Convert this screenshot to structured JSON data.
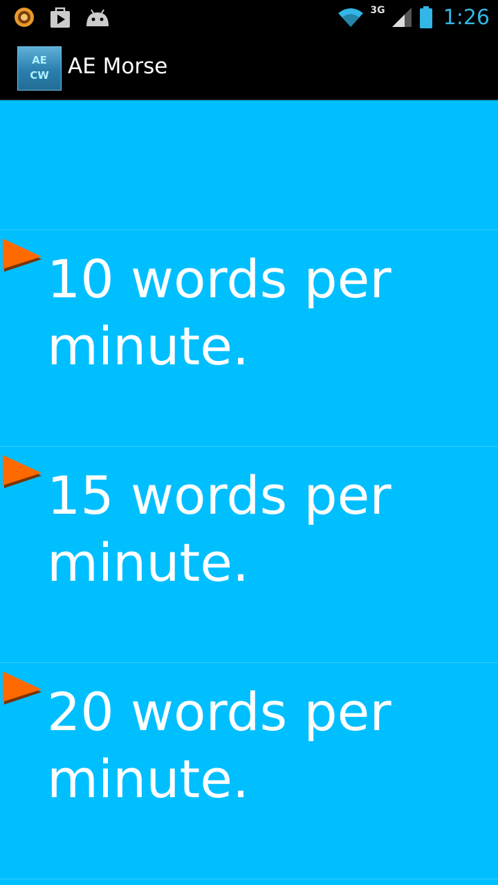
{
  "status_bar": {
    "network": "3G",
    "time": "1:26",
    "left_icons": [
      "circle-app-icon",
      "play-store-icon",
      "android-icon"
    ],
    "right_icons": [
      "wifi-icon",
      "signal-icon",
      "battery-icon"
    ]
  },
  "action_bar": {
    "app_icon_text_top": "AE",
    "app_icon_text_bottom": "CW",
    "title": "AE Morse"
  },
  "list": {
    "items": [
      {
        "label": "10 words per minute.",
        "icon": "play-arrow-icon"
      },
      {
        "label": "15 words per minute.",
        "icon": "play-arrow-icon"
      },
      {
        "label": "20 words per minute.",
        "icon": "play-arrow-icon"
      }
    ]
  },
  "colors": {
    "background": "#00bfff",
    "bar": "#000000",
    "accent": "#33b5e5",
    "arrow": "#ff6600",
    "text": "#ffffff"
  }
}
